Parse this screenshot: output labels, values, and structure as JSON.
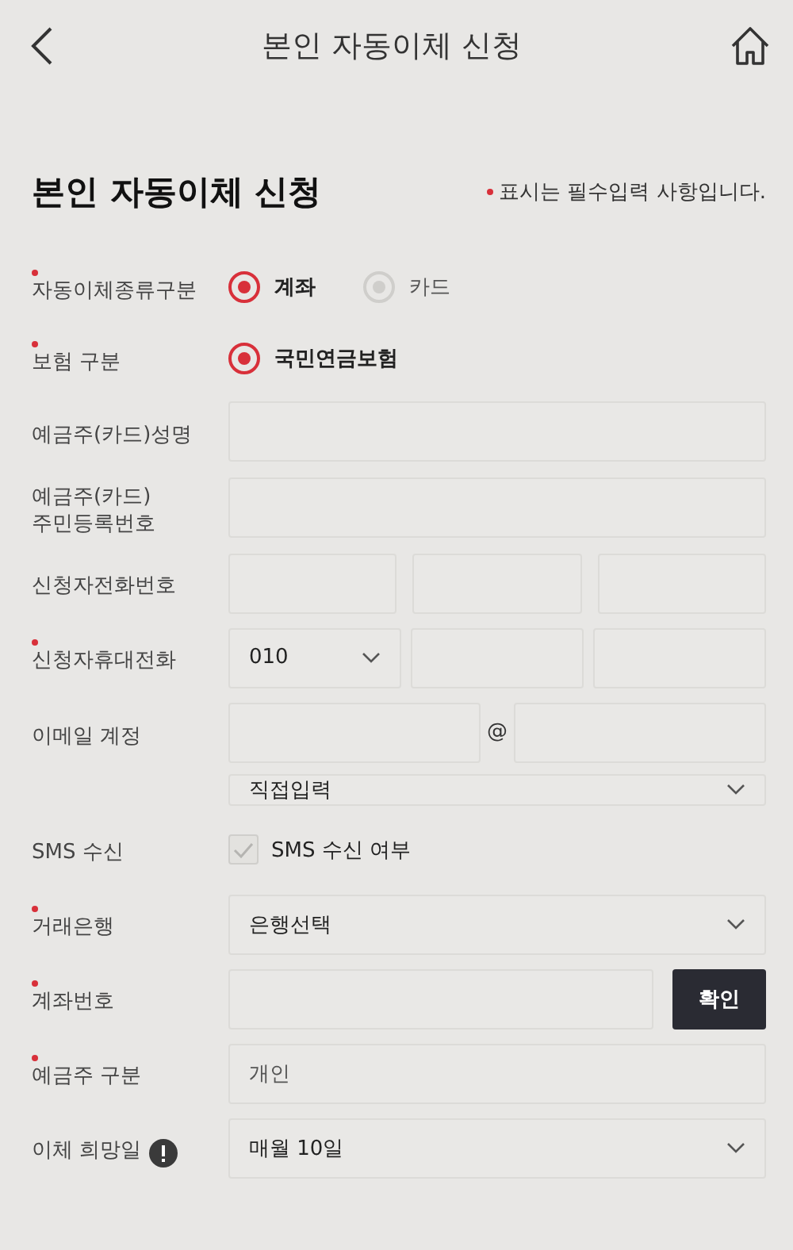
{
  "header": {
    "title": "본인 자동이체 신청"
  },
  "form": {
    "title": "본인 자동이체 신청",
    "required_note": "표시는 필수입력 사항입니다.",
    "rows": [
      {
        "kind": "radio",
        "label": "자동이체종류구분",
        "required": true,
        "options": [
          {
            "label": "계좌",
            "selected": true
          },
          {
            "label": "카드",
            "selected": false
          }
        ]
      },
      {
        "kind": "radio",
        "label": "보험 구분",
        "required": true,
        "options": [
          {
            "label": "국민연금보험",
            "selected": true
          }
        ]
      },
      {
        "kind": "text",
        "label": "예금주(카드)성명",
        "required": false
      },
      {
        "kind": "text",
        "label": "예금주(카드) 주민등록번호",
        "required": false
      },
      {
        "kind": "phone",
        "label": "신청자전화번호",
        "required": false
      },
      {
        "kind": "mobile",
        "label": "신청자휴대전화",
        "required": true,
        "prefix": "010"
      },
      {
        "kind": "email",
        "label": "이메일 계정",
        "required": false,
        "separator": "@",
        "domain": "직접입력"
      },
      {
        "kind": "checkbox",
        "label": "SMS 수신",
        "required": false,
        "option": "SMS 수신 여부",
        "checked": true,
        "disabled": true
      },
      {
        "kind": "select",
        "label": "거래은행",
        "required": true,
        "value": "은행선택"
      },
      {
        "kind": "account",
        "label": "계좌번호",
        "required": true,
        "button": "확인"
      },
      {
        "kind": "readonly",
        "label": "예금주 구분",
        "required": true,
        "value": "개인"
      },
      {
        "kind": "select",
        "label": "이체 희망일",
        "required": false,
        "info": true,
        "value": "매월 10일"
      }
    ]
  }
}
